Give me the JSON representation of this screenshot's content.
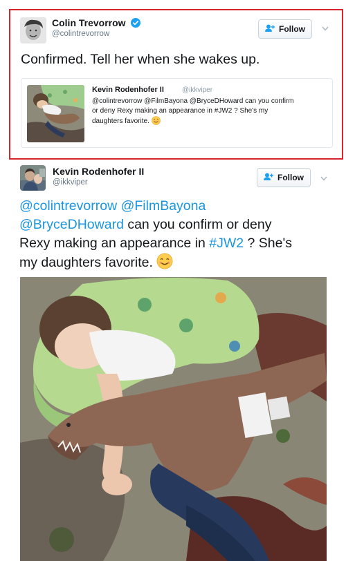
{
  "tweet1": {
    "author_name": "Colin Trevorrow",
    "author_handle": "@colintrevorrow",
    "follow_label": "Follow",
    "text": "Confirmed. Tell her when she wakes up.",
    "quote": {
      "author_name": "Kevin Rodenhofer II",
      "author_handle": "@ikkviper",
      "line1": "@colintrevorrow @FilmBayona @BryceDHoward can you confirm",
      "line2": "or deny Rexy making an appearance in #JW2 ? She's my",
      "line3": "daughters favorite."
    }
  },
  "tweet2": {
    "author_name": "Kevin Rodenhofer II",
    "author_handle": "@ikkviper",
    "follow_label": "Follow",
    "mention1": "@colintrevorrow",
    "mention2": "@FilmBayona",
    "mention3": "@BryceDHoward",
    "text_a": " can you confirm or deny",
    "text_b": "Rexy making an appearance in ",
    "hashtag": "#JW2",
    "text_c": " ? She's",
    "text_d": "my daughters favorite. "
  },
  "colors": {
    "highlight_border": "#d9242b",
    "link": "#1b95e0",
    "verified": "#1da1f2",
    "secondary_text": "#657786"
  },
  "icons": [
    "verified-badge-icon",
    "follow-person-plus-icon",
    "chevron-down-icon",
    "smiling-face-emoji"
  ]
}
